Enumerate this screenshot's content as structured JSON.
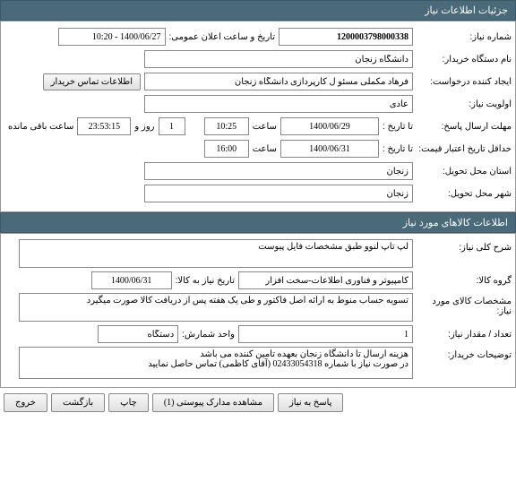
{
  "headers": {
    "need_info": "جزئیات اطلاعات نیاز",
    "goods_info": "اطلاعات کالاهای مورد نیاز"
  },
  "need": {
    "number_label": "شماره نیاز:",
    "number": "1200003798000338",
    "announce_label": "تاریخ و ساعت اعلان عمومی:",
    "announce": "1400/06/27 - 10:20",
    "buyer_label": "نام دستگاه خریدار:",
    "buyer": "دانشگاه زنجان",
    "requester_label": "ایجاد کننده درخواست:",
    "requester": "فرهاد مکملی مسئو ل کارپردازی دانشگاه زنجان",
    "contact_btn": "اطلاعات تماس خریدار",
    "priority_label": "اولویت نیاز:",
    "priority": "عادی",
    "deadline_label": "مهلت ارسال پاسخ:",
    "to_date_label": "تا تاریخ :",
    "deadline_date": "1400/06/29",
    "time_label": "ساعت",
    "deadline_time": "10:25",
    "days": "1",
    "days_label": "روز و",
    "remaining_time": "23:53:15",
    "remaining_label": "ساعت باقی مانده",
    "price_valid_label": "حداقل تاریخ اعتبار قیمت:",
    "price_valid_date": "1400/06/31",
    "price_valid_time": "16:00",
    "province_label": "استان محل تحویل:",
    "province": "زنجان",
    "city_label": "شهر محل تحویل:",
    "city": "زنجان"
  },
  "goods": {
    "desc_label": "شرح کلی نیاز:",
    "desc": "لپ تاپ لنوو طبق مشخصات فایل پیوست",
    "group_label": "گروه کالا:",
    "group": "کامپیوتر و فناوری اطلاعات-سخت افزار",
    "need_date_label": "تاریخ نیاز به کالا:",
    "need_date": "1400/06/31",
    "spec_label": "مشخصات کالای مورد نیاز:",
    "spec": "تسویه حساب منوط به ارائه اصل فاکتور و طی یک هفته پس از دریافت کالا صورت میگیرد",
    "qty_label": "تعداد / مقدار نیاز:",
    "qty": "1",
    "unit_label": "واحد شمارش:",
    "unit": "دستگاه",
    "notes_label": "توضیحات خریدار:",
    "notes": "هزینه ارسال تا دانشگاه زنجان بعهده تامین کننده می باشد\nدر صورت نیاز با شماره 02433054318 (آقای کاظمی) تماس حاصل نمایید"
  },
  "footer": {
    "respond": "پاسخ به نیاز",
    "attachments": "مشاهده مدارک پیوستی (1)",
    "print": "چاپ",
    "back": "بازگشت",
    "exit": "خروج"
  }
}
